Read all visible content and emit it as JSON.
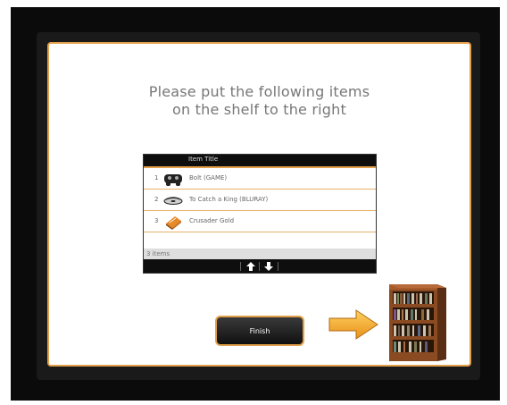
{
  "instruction": {
    "line1": "Please put the following items",
    "line2": "on the shelf to the right"
  },
  "item_list": {
    "header": "Item Title",
    "rows": [
      {
        "number": "1",
        "icon": "game-controller-icon",
        "title": "Bolt (GAME)"
      },
      {
        "number": "2",
        "icon": "bluray-disc-icon",
        "title": "To Catch a King (BLURAY)"
      },
      {
        "number": "3",
        "icon": "book-icon",
        "title": "Crusader Gold"
      }
    ],
    "count": "3 items"
  },
  "finish_button": {
    "label": "Finish"
  },
  "colors": {
    "accent": "#e2a04a",
    "arrow": "#f0a81e",
    "frame": "#0b0b0b"
  }
}
